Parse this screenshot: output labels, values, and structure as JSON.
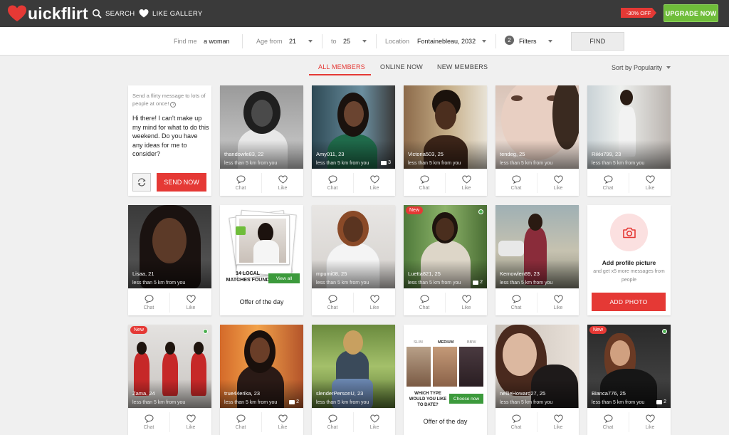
{
  "header": {
    "logo_text": "uickflirt",
    "nav": {
      "search": "SEARCH",
      "like_gallery": "LIKE GALLERY"
    },
    "discount": "-30% OFF",
    "upgrade": "UPGRADE NOW",
    "brand_color": "#e53935",
    "upgrade_color": "#6fbd3a"
  },
  "filters": {
    "find_me_label": "Find me",
    "find_me_value": "a woman",
    "age_from_label": "Age from",
    "age_from_value": "21",
    "age_to_label": "to",
    "age_to_value": "25",
    "location_label": "Location",
    "location_value": "Fontainebleau, 2032",
    "filters_count": "2",
    "filters_label": "Filters",
    "find_button": "FIND"
  },
  "tabs": {
    "all": "ALL MEMBERS",
    "online": "ONLINE NOW",
    "new": "NEW MEMBERS",
    "sort": "Sort by Popularity"
  },
  "actions": {
    "chat": "Chat",
    "like": "Like"
  },
  "message_card": {
    "hint": "Send a flirty message to lots of people at once!",
    "hint_icon": "question-icon",
    "message": "Hi there! I can't make up my mind for what to do this weekend. Do you have any ideas for me to consider?",
    "send": "SEND NOW"
  },
  "members": {
    "thandowfe83": {
      "name": "thandowfe83",
      "age": "22",
      "distance": "less than 5 km from you"
    },
    "amy011": {
      "name": "Amy011",
      "age": "23",
      "distance": "less than 5 km from you",
      "photos": "3"
    },
    "victoria503": {
      "name": "Victoria503",
      "age": "25",
      "distance": "less than 5 km from you"
    },
    "tendeg": {
      "name": "tendeg",
      "age": "25",
      "distance": "less than 5 km from you"
    },
    "rikki799": {
      "name": "Rikki799",
      "age": "23",
      "distance": "less than 5 km from you"
    },
    "lisaa": {
      "name": "Lisaa",
      "age": "21",
      "distance": "less than 5 km from you"
    },
    "mpumi08": {
      "name": "mpumi08",
      "age": "25",
      "distance": "less than 5 km from you"
    },
    "luetta821": {
      "name": "Luetta821",
      "age": "25",
      "distance": "less than 5 km from you",
      "photos": "2",
      "badge": "New"
    },
    "kemowlen89": {
      "name": "Kemowlen89",
      "age": "23",
      "distance": "less than 5 km from you"
    },
    "zama": {
      "name": "Zama",
      "age": "24",
      "distance": "less than 5 km from you",
      "badge": "New"
    },
    "true44erika": {
      "name": "true44erika",
      "age": "23",
      "distance": "less than 5 km from you",
      "photos": "2"
    },
    "slenderpersonu": {
      "name": "slenderPersonU",
      "age": "23",
      "distance": "less than 5 km from you"
    },
    "nellie": {
      "name": "nellieHoward27",
      "age": "25",
      "distance": "less than 5 km from you"
    },
    "bianca776": {
      "name": "Bianca776",
      "age": "25",
      "distance": "less than 5 km from you",
      "photos": "2",
      "badge": "New"
    }
  },
  "offer1": {
    "matches": "14 LOCAL MATCHES FOUND",
    "view": "View all",
    "title": "Offer of the day"
  },
  "offer2": {
    "types": [
      "SLIM",
      "MEDIUM",
      "BBW"
    ],
    "question": "WHICH TYPE WOULD YOU LIKE TO DATE?",
    "choose": "Choose now",
    "title": "Offer of the day"
  },
  "add_photo": {
    "title": "Add profile picture",
    "subtitle": "and get x5 more messages from people",
    "button": "ADD PHOTO"
  }
}
